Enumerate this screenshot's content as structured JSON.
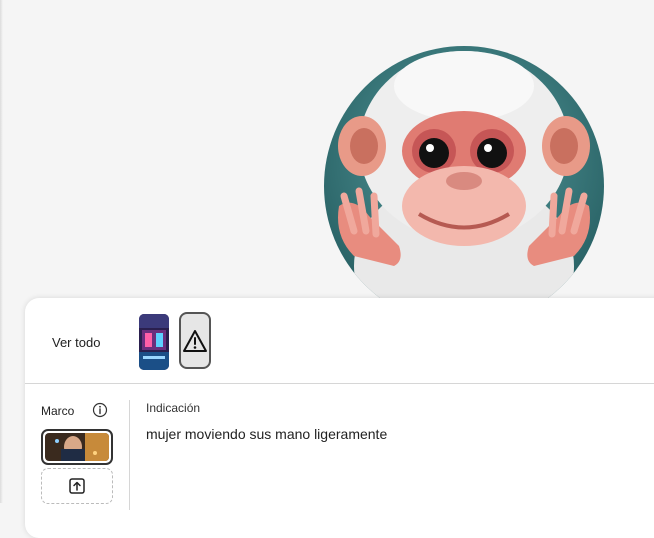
{
  "gallery": {
    "view_all_label": "Ver todo"
  },
  "frame": {
    "label": "Marco"
  },
  "prompt": {
    "label": "Indicación",
    "value": "mujer moviendo sus mano ligeramente"
  },
  "icons": {
    "info": "info-icon",
    "warning": "warning-icon",
    "upload": "upload-icon"
  },
  "colors": {
    "panel_bg": "#ffffff",
    "page_bg": "#f5f5f5",
    "avatar_bg": "#2f6e72"
  }
}
